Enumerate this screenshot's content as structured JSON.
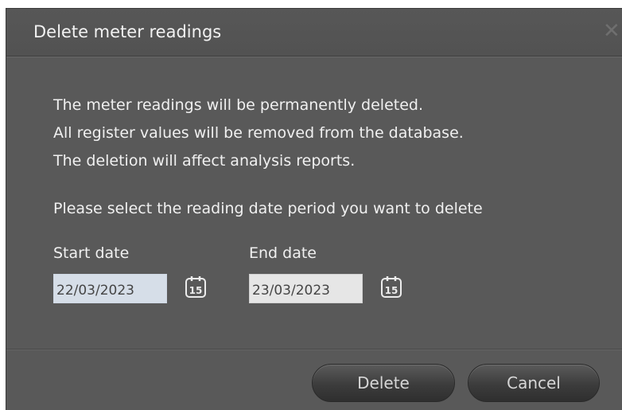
{
  "dialog": {
    "title": "Delete meter readings",
    "close_symbol": "✕",
    "messages": [
      "The meter readings will be permanently deleted.",
      "All register values will be removed from the database.",
      "The deletion will affect analysis reports."
    ],
    "prompt": "Please select the reading date period you want to delete",
    "start": {
      "label": "Start date",
      "value": "22/03/2023",
      "icon": "calendar-icon",
      "icon_day": "15"
    },
    "end": {
      "label": "End date",
      "value": "23/03/2023",
      "icon": "calendar-icon",
      "icon_day": "15"
    },
    "buttons": {
      "delete": "Delete",
      "cancel": "Cancel"
    }
  },
  "colors": {
    "dialog_bg": "#595959",
    "text": "#f0f0f0",
    "start_input_bg": "#d6dee8",
    "end_input_bg": "#e6e6e6"
  }
}
